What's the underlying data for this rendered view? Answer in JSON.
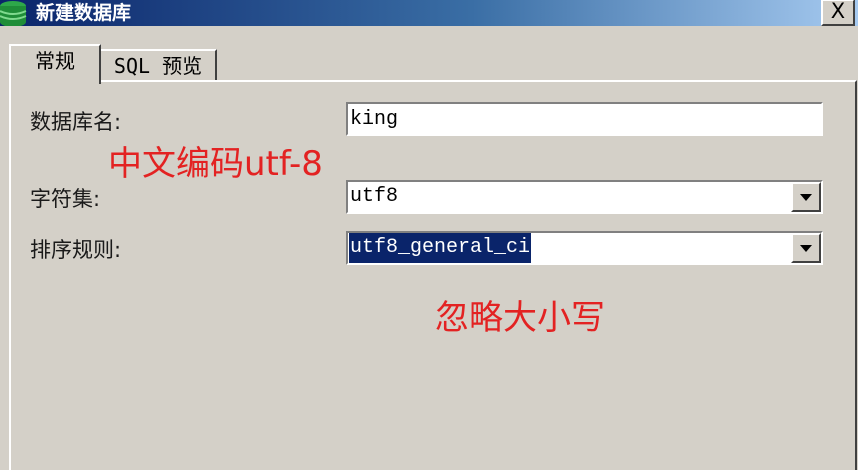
{
  "window": {
    "title": "新建数据库",
    "close_label": "X"
  },
  "tabs": [
    {
      "label": "常规",
      "active": true
    },
    {
      "label": "SQL 预览",
      "active": false
    }
  ],
  "form": {
    "db_name": {
      "label": "数据库名:",
      "value": "king"
    },
    "charset": {
      "label": "字符集:",
      "value": "utf8"
    },
    "collation": {
      "label": "排序规则:",
      "value": "utf8_general_ci"
    }
  },
  "annotations": {
    "charset_note": "中文编码utf-8",
    "collation_note": "忽略大小写"
  },
  "colors": {
    "annotation": "#e32222",
    "selection": "#0a246a",
    "title_gradient_start": "#0a246a",
    "title_gradient_end": "#a6caf0"
  },
  "icons": {
    "app": "database-icon",
    "close": "close-icon",
    "dropdown": "chevron-down-icon"
  }
}
